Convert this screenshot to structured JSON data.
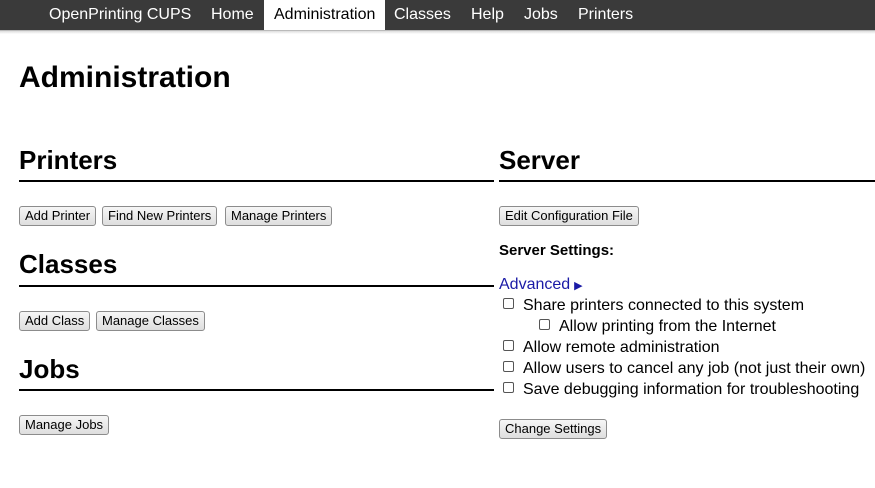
{
  "nav": {
    "items": [
      {
        "label": "OpenPrinting CUPS"
      },
      {
        "label": "Home"
      },
      {
        "label": "Administration"
      },
      {
        "label": "Classes"
      },
      {
        "label": "Help"
      },
      {
        "label": "Jobs"
      },
      {
        "label": "Printers"
      }
    ],
    "active": "Administration"
  },
  "page": {
    "title": "Administration"
  },
  "printers": {
    "heading": "Printers",
    "add_label": "Add Printer",
    "find_label": "Find New Printers",
    "manage_label": "Manage Printers"
  },
  "classes": {
    "heading": "Classes",
    "add_label": "Add Class",
    "manage_label": "Manage Classes"
  },
  "jobs": {
    "heading": "Jobs",
    "manage_label": "Manage Jobs"
  },
  "server": {
    "heading": "Server",
    "edit_config_label": "Edit Configuration File",
    "settings_label": "Server Settings:",
    "advanced_label": "Advanced",
    "advanced_icon": "triangle-right-icon",
    "options": [
      {
        "label": "Share printers connected to this system",
        "checked": false
      },
      {
        "label": "Allow printing from the Internet",
        "checked": false
      },
      {
        "label": "Allow remote administration",
        "checked": false
      },
      {
        "label": "Allow users to cancel any job (not just their own)",
        "checked": false
      },
      {
        "label": "Save debugging information for troubleshooting",
        "checked": false
      }
    ],
    "change_settings_label": "Change Settings"
  },
  "colors": {
    "navbar": "#3a3a3a",
    "link": "#1a1aa6"
  }
}
